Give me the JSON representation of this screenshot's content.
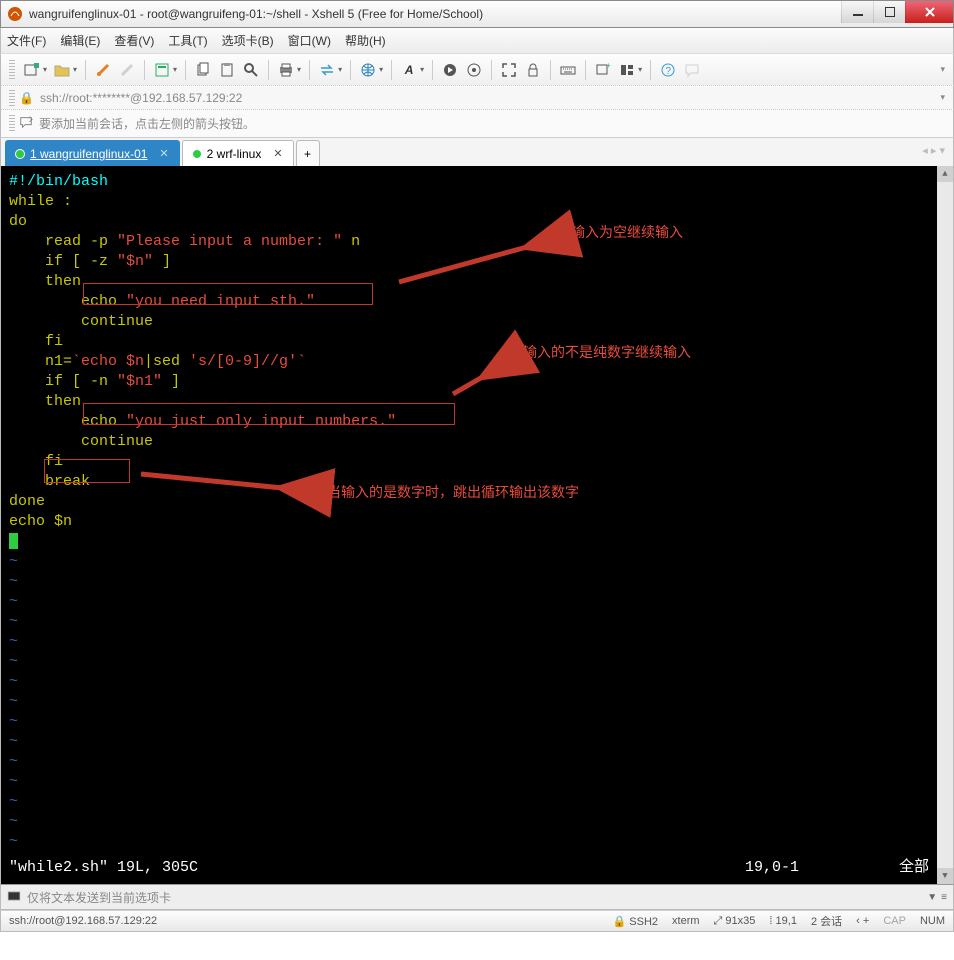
{
  "window": {
    "title": "wangruifenglinux-01 - root@wangruifeng-01:~/shell - Xshell 5 (Free for Home/School)"
  },
  "menu": {
    "file": "文件(F)",
    "edit": "编辑(E)",
    "view": "查看(V)",
    "tools": "工具(T)",
    "tabs": "选项卡(B)",
    "window": "窗口(W)",
    "help": "帮助(H)"
  },
  "address": {
    "text": "ssh://root:********@192.168.57.129:22"
  },
  "tip": {
    "text": "要添加当前会话，点击左侧的箭头按钮。"
  },
  "tabs": {
    "t1": {
      "label": "1 wangruifenglinux-01"
    },
    "t2": {
      "label": "2 wrf-linux"
    }
  },
  "code": {
    "l1": "#!/bin/bash",
    "l2": "while :",
    "l3": "do",
    "l4a": "    read -p ",
    "l4b": "\"Please input a number: \"",
    "l4c": " n",
    "l5a": "    if [ -z ",
    "l5b": "\"$n\"",
    "l5c": " ]",
    "l6": "    then",
    "l7a": "        echo ",
    "l7b": "\"you need input sth.\"",
    "l8": "        continue",
    "l9": "    fi",
    "l10a": "    n1=",
    "l10b": "`echo $n",
    "l10c": "|sed ",
    "l10d": "'s/[0-9]//g'",
    "l10e": "`",
    "l11a": "    if [ -n ",
    "l11b": "\"$n1\"",
    "l11c": " ]",
    "l12": "    then",
    "l13a": "        echo ",
    "l13b": "\"you just only input numbers.\"",
    "l14": "        continue",
    "l15": "    fi",
    "l16": "    break",
    "l17": "done",
    "l18a": "echo ",
    "l18b": "$n"
  },
  "annotations": {
    "a1": "输入为空继续输入",
    "a2": "输入的不是纯数字继续输入",
    "a3": "当输入的是数字时，跳出循环输出该数字"
  },
  "vim": {
    "file": "\"while2.sh\" 19L, 305C",
    "pos": "19,0-1",
    "all": "全部"
  },
  "footer": {
    "placeholder": "仅将文本发送到当前选项卡"
  },
  "status": {
    "addr": "ssh://root@192.168.57.129:22",
    "proto": "SSH2",
    "term": "xterm",
    "size": "91x35",
    "cursor": "19,1",
    "sessions": "2 会话",
    "cap": "CAP",
    "num": "NUM",
    "size_icon": "⤢",
    "cursor_icon": "⁞"
  }
}
